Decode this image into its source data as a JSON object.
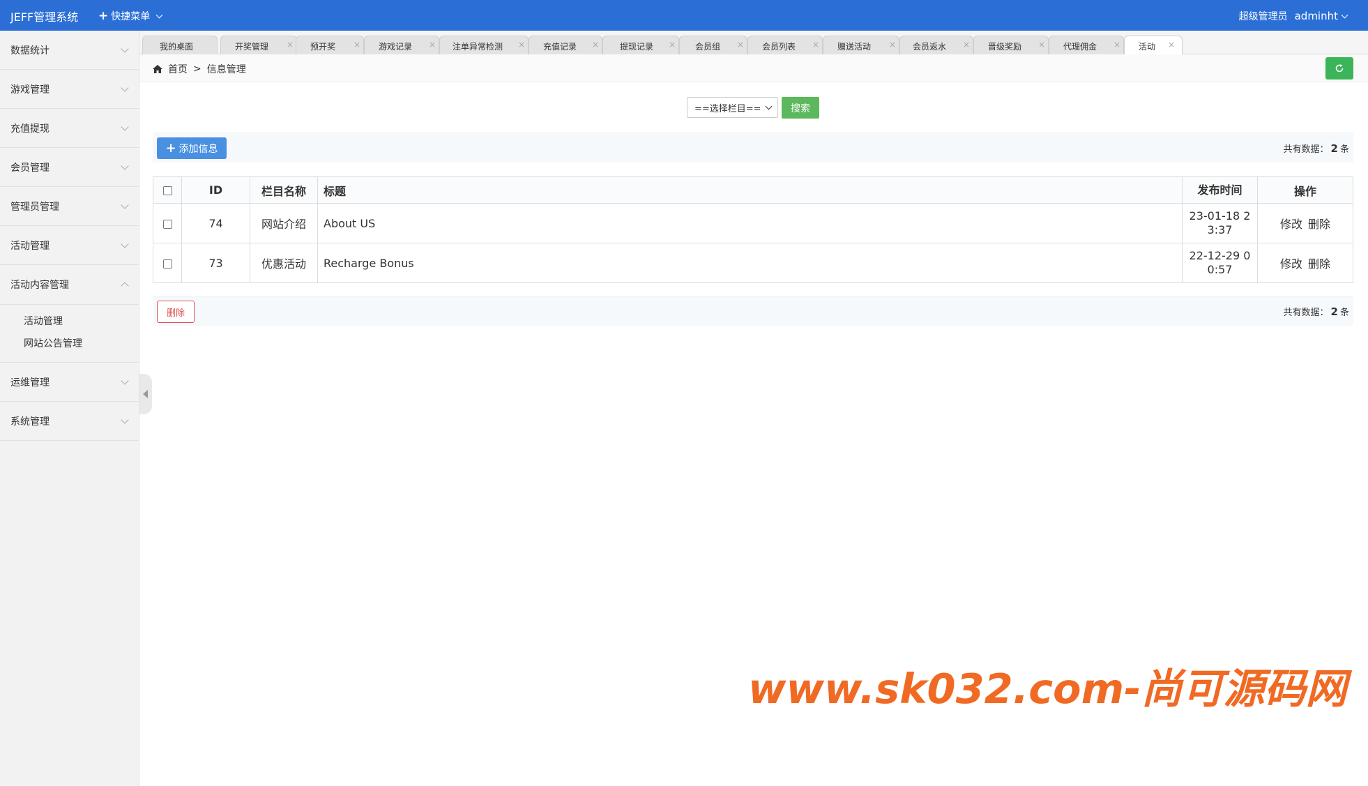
{
  "header": {
    "title": "JEFF管理系统",
    "quick_menu": "快捷菜单",
    "role": "超级管理员",
    "user": "adminht"
  },
  "sidebar": {
    "items": [
      {
        "label": "数据统计"
      },
      {
        "label": "游戏管理"
      },
      {
        "label": "充值提现"
      },
      {
        "label": "会员管理"
      },
      {
        "label": "管理员管理"
      },
      {
        "label": "活动管理"
      },
      {
        "label": "活动内容管理"
      },
      {
        "label": "运维管理"
      },
      {
        "label": "系统管理"
      }
    ],
    "submenu": [
      "活动管理",
      "网站公告管理"
    ]
  },
  "tabs": [
    "我的桌面",
    "开奖管理",
    "预开奖",
    "游戏记录",
    "注单异常检测",
    "充值记录",
    "提现记录",
    "会员组",
    "会员列表",
    "赠送活动",
    "会员返水",
    "晋级奖励",
    "代理佣金",
    "活动"
  ],
  "breadcrumb": {
    "home": "首页",
    "sep": ">",
    "current": "信息管理"
  },
  "search": {
    "select_value": "==选择栏目==",
    "button": "搜索"
  },
  "toolbar": {
    "add_label": "添加信息",
    "delete_label": "删除",
    "total_prefix": "共有数据：",
    "total_count": "2",
    "total_suffix": "条"
  },
  "table": {
    "headers": {
      "id": "ID",
      "column": "栏目名称",
      "title": "标题",
      "time": "发布时间",
      "ops": "操作"
    },
    "rows": [
      {
        "id": "74",
        "column": "网站介绍",
        "title": "About US",
        "time_l1": "23-01-18 2",
        "time_l2": "3:37",
        "edit": "修改",
        "delete": "删除"
      },
      {
        "id": "73",
        "column": "优惠活动",
        "title": "Recharge Bonus",
        "time_l1": "22-12-29 0",
        "time_l2": "0:57",
        "edit": "修改",
        "delete": "删除"
      }
    ]
  },
  "watermark": "www.sk032.com-尚可源码网",
  "colors": {
    "header": "#2b6fd6",
    "refresh": "#3cb45a",
    "search": "#5cb85c",
    "add": "#4a90e2",
    "delete": "#d9534f",
    "watermark": "#f06a24"
  }
}
